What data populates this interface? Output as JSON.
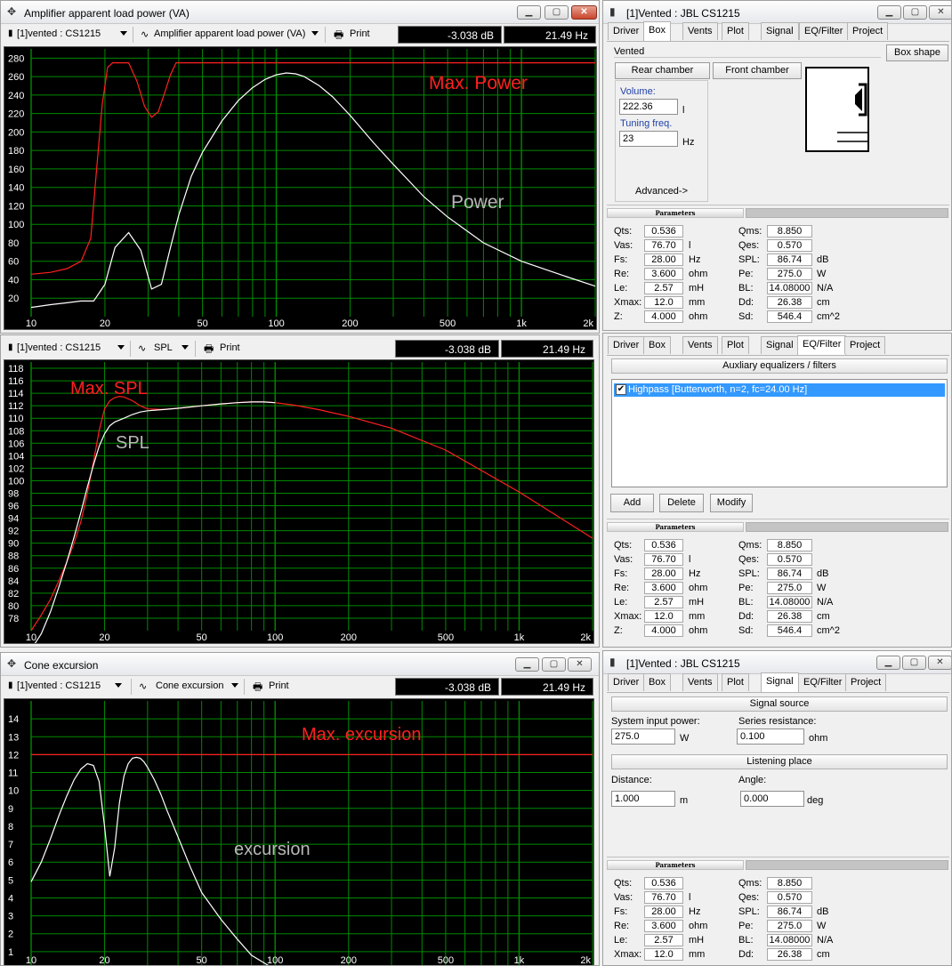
{
  "common": {
    "curve_selector": "[1]vented : CS1215",
    "print_label": "Print",
    "db_readout": "-3.038 dB",
    "hz_readout": "21.49 Hz"
  },
  "power_window": {
    "title": "Amplifier apparent load power (VA)",
    "plot_selector": "Amplifier apparent load power (VA)",
    "annot_max": "Max. Power",
    "annot_curve": "Power"
  },
  "spl_window": {
    "plot_selector": "SPL",
    "annot_max": "Max. SPL",
    "annot_curve": "SPL"
  },
  "exc_window": {
    "title": "Cone excursion",
    "plot_selector": "Cone excursion",
    "annot_max": "Max. excursion",
    "annot_curve": "excursion"
  },
  "x_axis_labels": [
    "10",
    "20",
    "50",
    "100",
    "200",
    "500",
    "1k",
    "2k"
  ],
  "chart_data": [
    {
      "type": "line",
      "title": "Amplifier apparent load power (VA)",
      "x_scale": "log",
      "xlim": [
        10,
        2000
      ],
      "ylim": [
        0,
        290
      ],
      "y_ticks": [
        20,
        40,
        60,
        80,
        100,
        120,
        140,
        160,
        180,
        200,
        220,
        240,
        260,
        280
      ],
      "grid": true,
      "series": [
        {
          "name": "Max. Power",
          "color": "#ff2020",
          "x": [
            10,
            12,
            14,
            16,
            17.5,
            18.5,
            19.5,
            20.5,
            21.5,
            25,
            27,
            29,
            31,
            33,
            35,
            37,
            39,
            2000
          ],
          "y": [
            46,
            48,
            52,
            60,
            85,
            160,
            230,
            270,
            275,
            275,
            255,
            228,
            216,
            222,
            242,
            262,
            275,
            275
          ]
        },
        {
          "name": "Power",
          "color": "#ffffff",
          "x": [
            10,
            12,
            14,
            16,
            18,
            20,
            22,
            25,
            28,
            31,
            34,
            37,
            40,
            45,
            50,
            60,
            70,
            80,
            90,
            100,
            110,
            120,
            130,
            150,
            170,
            200,
            250,
            300,
            400,
            500,
            700,
            1000,
            1500,
            2000
          ],
          "y": [
            10,
            13,
            15,
            17,
            17,
            35,
            75,
            91,
            72,
            30,
            35,
            75,
            110,
            152,
            178,
            212,
            234,
            248,
            257,
            262,
            264,
            263,
            260,
            250,
            238,
            218,
            188,
            165,
            130,
            108,
            80,
            60,
            44,
            33
          ]
        }
      ]
    },
    {
      "type": "line",
      "title": "",
      "x_scale": "log",
      "xlim": [
        10,
        2000
      ],
      "ylim": [
        76,
        119
      ],
      "y_ticks": [
        78,
        80,
        82,
        84,
        86,
        88,
        90,
        92,
        94,
        96,
        98,
        100,
        102,
        104,
        106,
        108,
        110,
        112,
        114,
        116,
        118
      ],
      "grid": true,
      "series": [
        {
          "name": "Max. SPL",
          "color": "#ff2020",
          "x": [
            10,
            11,
            12,
            13,
            14,
            15,
            16,
            17,
            18,
            19,
            20,
            21,
            22,
            23,
            24,
            26,
            28,
            30,
            35,
            40,
            50,
            60,
            70,
            80,
            90,
            100,
            120,
            150,
            200,
            300,
            500,
            1000,
            2000
          ],
          "y": [
            76,
            78.5,
            81,
            84,
            87,
            90,
            93.5,
            98,
            103,
            108,
            111.5,
            112.8,
            113.3,
            113.5,
            113.4,
            112.8,
            112.0,
            111.5,
            111.4,
            111.6,
            112.0,
            112.3,
            112.5,
            112.6,
            112.6,
            112.5,
            112.1,
            111.4,
            110.3,
            108.4,
            104.9,
            98.2,
            90.8
          ]
        },
        {
          "name": "SPL",
          "color": "#ffffff",
          "x": [
            10,
            11,
            12,
            13,
            14,
            15,
            16,
            17,
            18,
            19,
            20,
            21,
            22,
            24,
            26,
            28,
            30,
            35,
            40,
            50,
            60,
            70,
            80,
            90,
            100
          ],
          "y": [
            73,
            75.5,
            79,
            83,
            87,
            91,
            95,
            99,
            102.5,
            105.5,
            107.5,
            108.8,
            109.4,
            110.0,
            110.6,
            111.0,
            111.2,
            111.4,
            111.6,
            112.0,
            112.3,
            112.5,
            112.6,
            112.6,
            112.5
          ]
        }
      ]
    },
    {
      "type": "line",
      "title": "Cone excursion",
      "x_scale": "log",
      "xlim": [
        10,
        2000
      ],
      "ylim": [
        0,
        15
      ],
      "y_ticks": [
        1,
        2,
        3,
        4,
        5,
        6,
        7,
        8,
        9,
        10,
        11,
        12,
        13,
        14
      ],
      "grid": true,
      "series": [
        {
          "name": "Max. excursion",
          "color": "#ff2020",
          "x": [
            10,
            2000
          ],
          "y": [
            12,
            12
          ]
        },
        {
          "name": "excursion",
          "color": "#ffffff",
          "x": [
            10,
            11,
            12,
            13,
            14,
            15,
            16,
            17,
            18,
            19,
            20,
            21,
            22,
            23,
            24,
            25,
            26,
            27,
            28,
            29,
            30,
            32,
            34,
            36,
            40,
            45,
            50,
            60,
            70,
            80,
            100
          ],
          "y": [
            4.9,
            6.0,
            7.3,
            8.6,
            9.7,
            10.6,
            11.2,
            11.5,
            11.4,
            10.5,
            8.0,
            5.2,
            6.8,
            9.3,
            10.8,
            11.5,
            11.8,
            11.85,
            11.8,
            11.6,
            11.3,
            10.6,
            9.8,
            8.9,
            7.4,
            5.7,
            4.3,
            2.8,
            1.7,
            0.8,
            0
          ]
        }
      ]
    }
  ],
  "box_panel": {
    "title": "[1]Vented : JBL CS1215",
    "tabs": [
      "Driver",
      "Box",
      "Vents",
      "Plot",
      "Signal",
      "EQ/Filter",
      "Project"
    ],
    "box_type": "Vented",
    "box_shape_button": "Box shape",
    "rear_chamber": "Rear chamber",
    "front_chamber": "Front chamber",
    "volume_label": "Volume:",
    "volume_value": "222.36",
    "volume_unit": "l",
    "tuning_label": "Tuning freq.",
    "tuning_value": "23",
    "tuning_unit": "Hz",
    "advanced": "Advanced->"
  },
  "eq_panel": {
    "tabs": [
      "Driver",
      "Box",
      "Vents",
      "Plot",
      "Signal",
      "EQ/Filter",
      "Project"
    ],
    "section": "Auxliary equalizers / filters",
    "filter_item": "Highpass [Butterworth, n=2, fc=24.00 Hz]",
    "add": "Add",
    "delete": "Delete",
    "modify": "Modify"
  },
  "signal_panel": {
    "title": "[1]Vented : JBL CS1215",
    "tabs": [
      "Driver",
      "Box",
      "Vents",
      "Plot",
      "Signal",
      "EQ/Filter",
      "Project"
    ],
    "section_source": "Signal source",
    "input_power_label": "System input power:",
    "input_power_value": "275.0",
    "input_power_unit": "W",
    "series_res_label": "Series resistance:",
    "series_res_value": "0.100",
    "series_res_unit": "ohm",
    "section_listening": "Listening place",
    "distance_label": "Distance:",
    "distance_value": "1.000",
    "distance_unit": "m",
    "angle_label": "Angle:",
    "angle_value": "0.000",
    "angle_unit": "deg"
  },
  "parameters": {
    "heading": "Parameters",
    "left": [
      {
        "label": "Qts:",
        "value": "0.536",
        "unit": ""
      },
      {
        "label": "Vas:",
        "value": "76.70",
        "unit": "l"
      },
      {
        "label": "Fs:",
        "value": "28.00",
        "unit": "Hz"
      },
      {
        "label": "Re:",
        "value": "3.600",
        "unit": "ohm"
      },
      {
        "label": "Le:",
        "value": "2.57",
        "unit": "mH"
      },
      {
        "label": "Xmax:",
        "value": "12.0",
        "unit": "mm"
      },
      {
        "label": "Z:",
        "value": "4.000",
        "unit": "ohm"
      }
    ],
    "right": [
      {
        "label": "Qms:",
        "value": "8.850",
        "unit": ""
      },
      {
        "label": "Qes:",
        "value": "0.570",
        "unit": ""
      },
      {
        "label": "SPL:",
        "value": "86.74",
        "unit": "dB"
      },
      {
        "label": "Pe:",
        "value": "275.0",
        "unit": "W"
      },
      {
        "label": "BL:",
        "value": "14.08000",
        "unit": "N/A"
      },
      {
        "label": "Dd:",
        "value": "26.38",
        "unit": "cm"
      },
      {
        "label": "Sd:",
        "value": "546.4",
        "unit": "cm^2"
      }
    ]
  }
}
